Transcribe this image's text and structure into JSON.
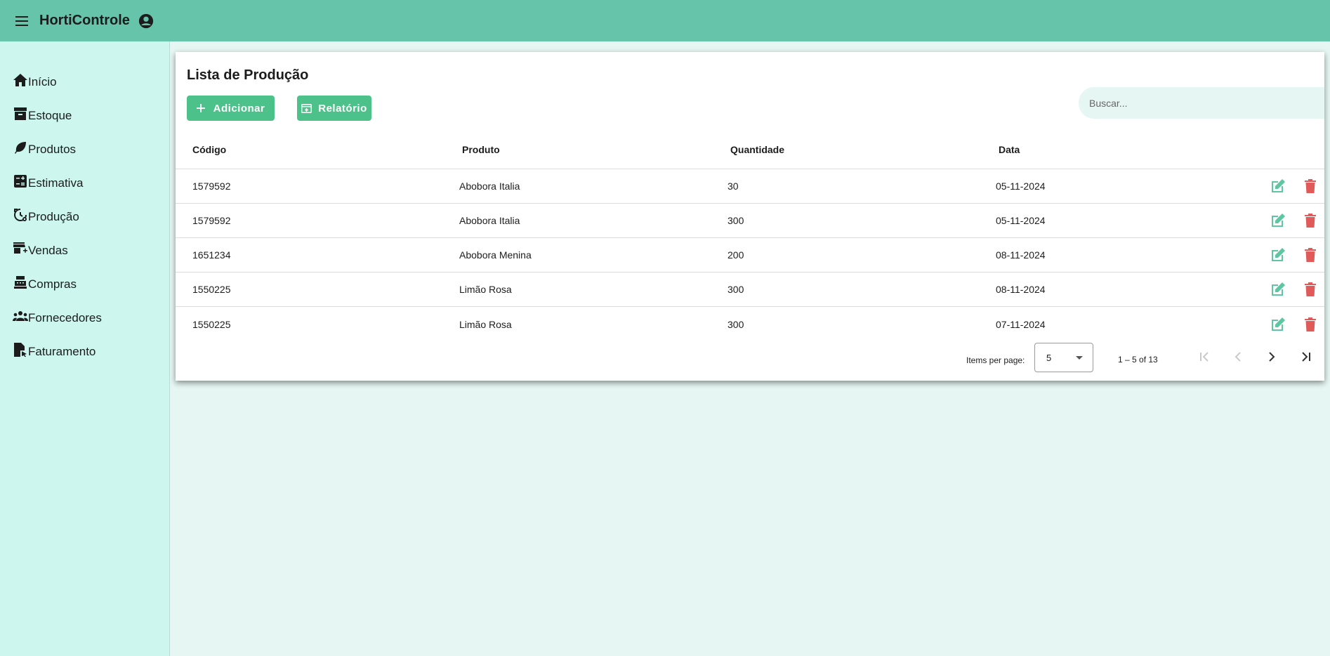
{
  "app": {
    "title": "HortiControle"
  },
  "sidebar": {
    "items": [
      {
        "label": "Início",
        "icon": "home-icon"
      },
      {
        "label": "Estoque",
        "icon": "archive-icon"
      },
      {
        "label": "Produtos",
        "icon": "leaf-icon"
      },
      {
        "label": "Estimativa",
        "icon": "calculator-icon"
      },
      {
        "label": "Produção",
        "icon": "history-settings-icon"
      },
      {
        "label": "Vendas",
        "icon": "store-add-icon"
      },
      {
        "label": "Compras",
        "icon": "cash-register-icon"
      },
      {
        "label": "Fornecedores",
        "icon": "group-icon"
      },
      {
        "label": "Faturamento",
        "icon": "file-cursor-icon"
      }
    ]
  },
  "main": {
    "title": "Lista de Produção",
    "add_label": "Adicionar",
    "report_label": "Relatório",
    "search_placeholder": "Buscar..."
  },
  "table": {
    "headers": {
      "code": "Código",
      "product": "Produto",
      "quantity": "Quantidade",
      "date": "Data"
    },
    "rows": [
      {
        "code": "1579592",
        "product": "Abobora Italia",
        "quantity": "30",
        "date": "05-11-2024"
      },
      {
        "code": "1579592",
        "product": "Abobora Italia",
        "quantity": "300",
        "date": "05-11-2024"
      },
      {
        "code": "1651234",
        "product": "Abobora Menina",
        "quantity": "200",
        "date": "08-11-2024"
      },
      {
        "code": "1550225",
        "product": "Limão Rosa",
        "quantity": "300",
        "date": "08-11-2024"
      },
      {
        "code": "1550225",
        "product": "Limão Rosa",
        "quantity": "300",
        "date": "07-11-2024"
      }
    ]
  },
  "paginator": {
    "items_per_page_label": "Items per page:",
    "page_size": "5",
    "range_label": "1 – 5 of 13"
  },
  "colors": {
    "topbar": "#66c4aa",
    "sidebar": "#ccf6ee",
    "accent_button": "#4cc28a",
    "edit_icon": "#5ec7a1",
    "delete_icon": "#e05a5a"
  }
}
